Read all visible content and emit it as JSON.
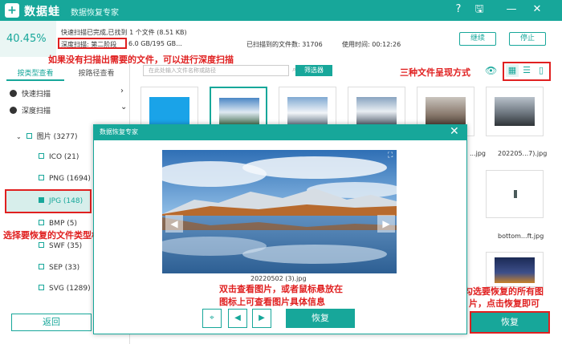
{
  "app": {
    "logo_glyph": "+",
    "name": "数据蛙",
    "subtitle": "数据恢复专家"
  },
  "window": {
    "help_glyph": "?",
    "save_glyph": "🖫",
    "minimize_glyph": "—",
    "close_glyph": "✕"
  },
  "progress": {
    "percent": "40.45%",
    "quick_status": "快速扫描已完成,已找到 1 个文件 (8.51 KB)",
    "deep_status": "深度扫描: 第二阶段",
    "size_info": "6.0 GB/195 GB...",
    "found_info": "已扫描到的文件数: 31706",
    "time_info": "使用时间: 00:12:26"
  },
  "header_buttons": {
    "continue": "继续",
    "stop": "停止"
  },
  "sidebar": {
    "tab_type": "按类型查看",
    "tab_path": "按路径查看",
    "quick_scan": "快速扫描",
    "deep_scan": "深度扫描",
    "images": "图片 (3277)",
    "formats": [
      {
        "label": "ICO (21)"
      },
      {
        "label": "PNG (1694)"
      },
      {
        "label": "JPG (148)"
      },
      {
        "label": "BMP (5)"
      },
      {
        "label": "SWF (35)"
      },
      {
        "label": "SEP (33)"
      },
      {
        "label": "SVG (1289)"
      }
    ],
    "back_button": "返回"
  },
  "toolbar": {
    "search_placeholder": "在此处输入文件名称或路径",
    "filter_button": "筛选器",
    "view_icons": [
      "▦",
      "☰",
      "▯"
    ]
  },
  "files": {
    "name_1": "...jpg",
    "name_2": "202205...7).jpg",
    "name_3": "bottom...ft.jpg",
    "name_4": "...jpg"
  },
  "recover_main": "恢复",
  "dialog": {
    "title": "数据恢复专家",
    "close_glyph": "✕",
    "preview_name": "20220502 (3).jpg",
    "prev_glyph": "◀",
    "next_glyph": "▶",
    "fit_glyph": "⌖",
    "recover": "恢复"
  },
  "annotations": {
    "deep_scan": "如果没有扫描出需要的文件，可以进行深度扫描",
    "view_modes": "三种文件呈现方式",
    "choose_type": "选择要恢复的文件类型格式",
    "preview_1": "双击查看图片，或者鼠标悬放在",
    "preview_2": "图标上可查看图片具体信息",
    "select_1": "勾选要恢复的所有图",
    "select_2": "片，点击恢复即可"
  },
  "colors": {
    "brand": "#17a79a",
    "annotation": "#e02020"
  }
}
